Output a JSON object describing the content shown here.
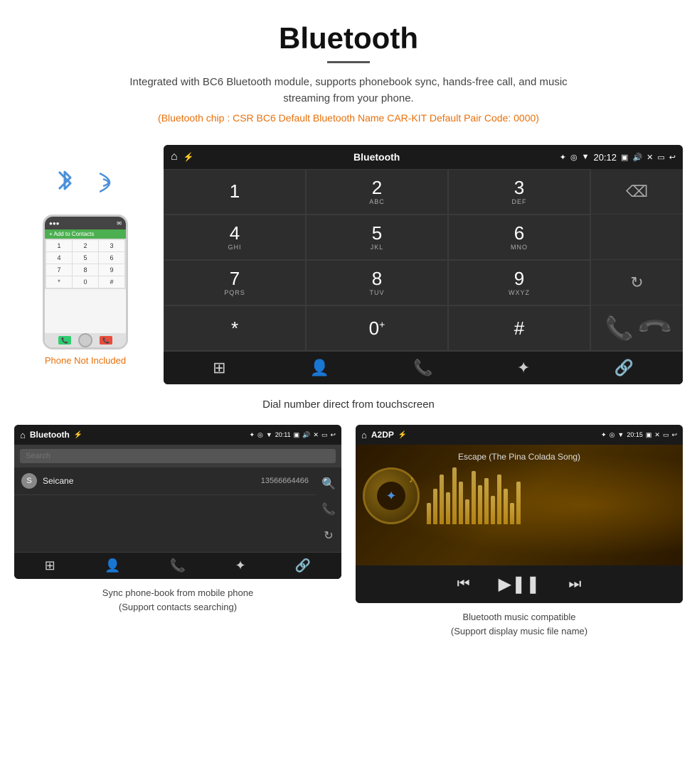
{
  "page": {
    "title": "Bluetooth",
    "description": "Integrated with BC6 Bluetooth module, supports phonebook sync, hands-free call, and music streaming from your phone.",
    "specs": "(Bluetooth chip : CSR BC6    Default Bluetooth Name CAR-KIT    Default Pair Code: 0000)"
  },
  "car_screen": {
    "status_bar": {
      "title": "Bluetooth",
      "time": "20:12"
    },
    "dialpad": {
      "keys": [
        {
          "num": "1",
          "letters": ""
        },
        {
          "num": "2",
          "letters": "ABC"
        },
        {
          "num": "3",
          "letters": "DEF"
        },
        {
          "num": "4",
          "letters": "GHI"
        },
        {
          "num": "5",
          "letters": "JKL"
        },
        {
          "num": "6",
          "letters": "MNO"
        },
        {
          "num": "7",
          "letters": "PQRS"
        },
        {
          "num": "8",
          "letters": "TUV"
        },
        {
          "num": "9",
          "letters": "WXYZ"
        },
        {
          "num": "*",
          "letters": ""
        },
        {
          "num": "0",
          "letters": "+"
        },
        {
          "num": "#",
          "letters": ""
        }
      ]
    }
  },
  "dialpad_caption": "Dial number direct from touchscreen",
  "phonebook_screen": {
    "status_bar": {
      "title": "Bluetooth",
      "time": "20:11"
    },
    "search_placeholder": "Search",
    "contacts": [
      {
        "initial": "S",
        "name": "Seicane",
        "number": "13566664466"
      }
    ]
  },
  "phonebook_caption": "Sync phone-book from mobile phone\n(Support contacts searching)",
  "music_screen": {
    "status_bar": {
      "title": "A2DP",
      "time": "20:15"
    },
    "song_title": "Escape (The Pina Colada Song)"
  },
  "music_caption": "Bluetooth music compatible\n(Support display music file name)",
  "phone_label": "Phone Not Included",
  "phone_keys": [
    "1",
    "2",
    "3",
    "4",
    "5",
    "6",
    "7",
    "8",
    "9",
    "*",
    "0",
    "#"
  ],
  "viz_bars": [
    30,
    50,
    70,
    45,
    80,
    60,
    35,
    75,
    55,
    65,
    40,
    70,
    50,
    30,
    60
  ]
}
